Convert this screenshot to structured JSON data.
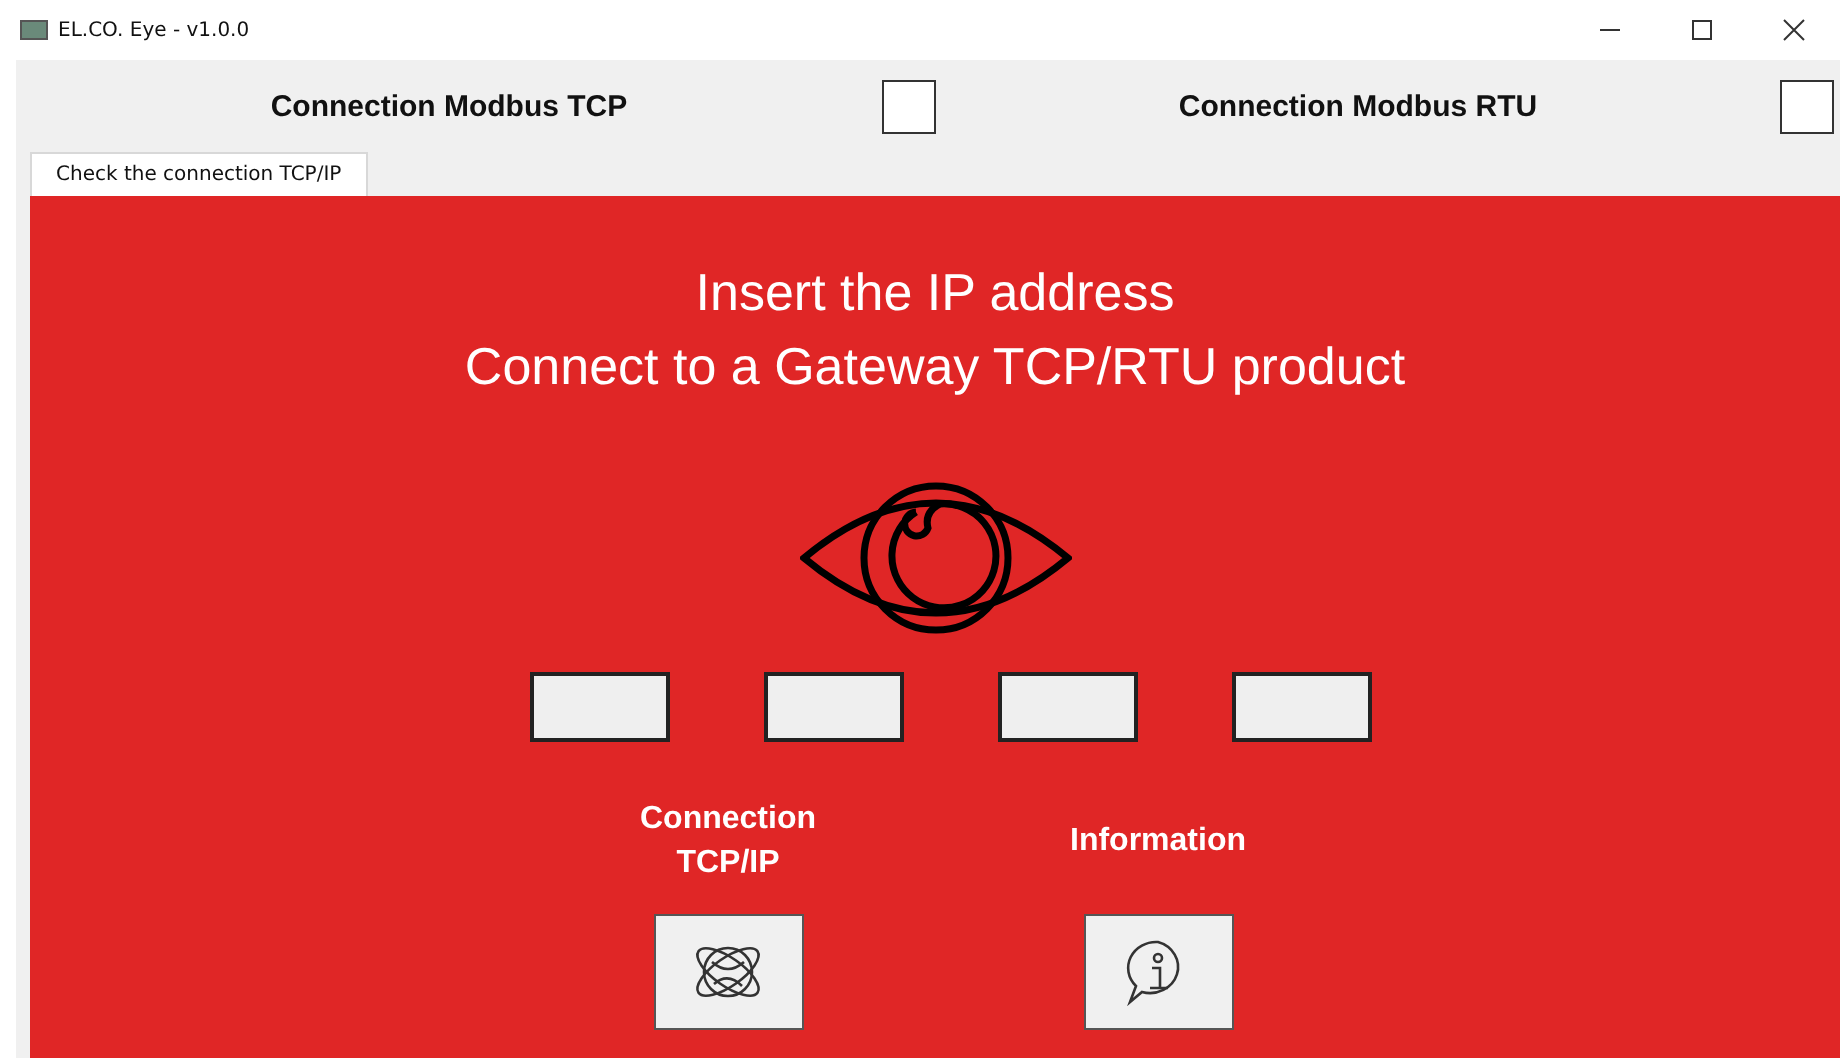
{
  "window": {
    "title": "EL.CO. Eye - v1.0.0"
  },
  "modes": [
    {
      "label": "Connection Modbus TCP",
      "checked": false
    },
    {
      "label": "Connection Modbus RTU",
      "checked": false
    }
  ],
  "tabs": [
    {
      "label": "Check the connection TCP/IP",
      "selected": true
    }
  ],
  "panel": {
    "heading_lines": [
      "Insert the IP address",
      "Connect to a Gateway TCP/RTU product"
    ],
    "ip_octets": [
      {
        "kind": "octet"
      },
      {
        "kind": "octet"
      },
      {
        "kind": "octet"
      },
      {
        "kind": "octet"
      }
    ],
    "actions": [
      {
        "kind": "network",
        "label_lines": [
          "Connection",
          "TCP/IP"
        ]
      },
      {
        "kind": "info",
        "label_lines": [
          "Information"
        ]
      }
    ]
  }
}
